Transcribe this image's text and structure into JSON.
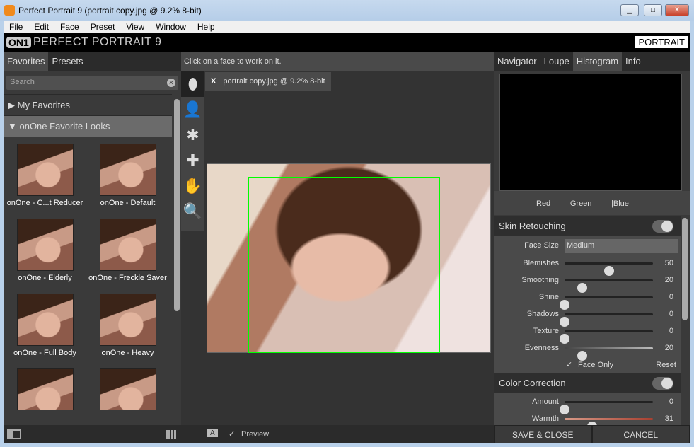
{
  "window": {
    "title": "Perfect Portrait 9 (portrait copy.jpg @ 9.2% 8-bit)",
    "minimize": "▁",
    "maximize": "□",
    "close": "✕"
  },
  "menu": [
    "File",
    "Edit",
    "Face",
    "Preset",
    "View",
    "Window",
    "Help"
  ],
  "brand": {
    "logo": "ON1",
    "name": "PERFECT PORTRAIT 9",
    "mode": "PORTRAIT"
  },
  "left": {
    "tabs": [
      "Favorites",
      "Presets"
    ],
    "search_placeholder": "Search",
    "groups": [
      "▶ My Favorites",
      "▼ onOne Favorite Looks"
    ],
    "thumbs": [
      "onOne - C...t Reducer",
      "onOne - Default",
      "onOne - Elderly",
      "onOne - Freckle Saver",
      "onOne - Full Body",
      "onOne - Heavy",
      "",
      ""
    ]
  },
  "center": {
    "hint": "Click on a face to work on it.",
    "doc_tab": "portrait copy.jpg @ 9.2% 8-bit",
    "close": "X",
    "tools": [
      "face-select",
      "person",
      "spot-brush",
      "bandage",
      "hand",
      "zoom"
    ],
    "preview": "Preview",
    "preview_checked": true,
    "a_label": "A"
  },
  "right": {
    "tabs": [
      "Navigator",
      "Loupe",
      "Histogram",
      "Info"
    ],
    "active_tab": "Histogram",
    "channels": [
      "Red",
      "|Green",
      "|Blue"
    ],
    "skin": {
      "title": "Skin Retouching",
      "enabled": true,
      "face_size_label": "Face Size",
      "face_size": "Medium",
      "sliders": [
        {
          "label": "Blemishes",
          "value": 50
        },
        {
          "label": "Smoothing",
          "value": 20
        },
        {
          "label": "Shine",
          "value": 0
        },
        {
          "label": "Shadows",
          "value": 0
        },
        {
          "label": "Texture",
          "value": 0
        },
        {
          "label": "Evenness",
          "value": 20
        }
      ],
      "face_only": "Face Only",
      "face_only_checked": true,
      "reset": "Reset"
    },
    "color": {
      "title": "Color Correction",
      "enabled": true,
      "sliders": [
        {
          "label": "Amount",
          "value": 0
        },
        {
          "label": "Warmth",
          "value": 31
        }
      ]
    },
    "save": "SAVE & CLOSE",
    "cancel": "CANCEL"
  }
}
